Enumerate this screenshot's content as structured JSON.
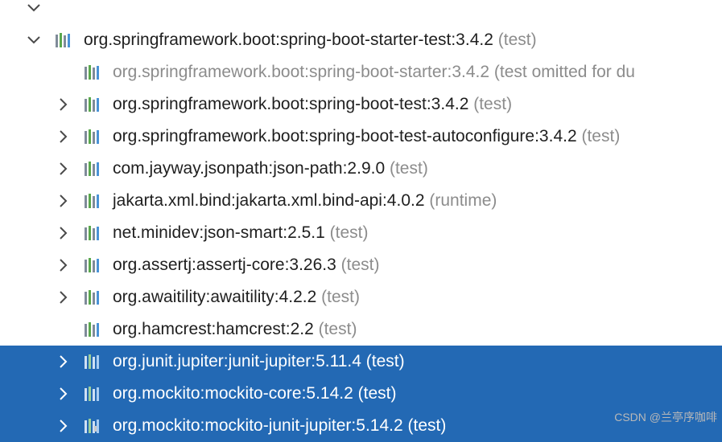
{
  "tree": {
    "top_partial": {
      "label": "org.springframework.boot:spring-boot-starter-test:3.4.2",
      "scope": "(test)",
      "expanded": true
    },
    "rows": [
      {
        "name": "",
        "scope": "",
        "expandable": false,
        "expanded": false,
        "omitted": false,
        "selected": false
      },
      {
        "name": "org.springframework.boot:spring-boot-starter-test:3.4.2",
        "scope": "(test)",
        "expandable": true,
        "expanded": true,
        "omitted": false,
        "selected": false,
        "depth": 0
      },
      {
        "name": "org.springframework.boot:spring-boot-starter:3.4.2",
        "scope": "(test omitted for du",
        "expandable": false,
        "expanded": false,
        "omitted": true,
        "selected": false,
        "depth": 1
      },
      {
        "name": "org.springframework.boot:spring-boot-test:3.4.2",
        "scope": "(test)",
        "expandable": true,
        "expanded": false,
        "omitted": false,
        "selected": false,
        "depth": 1
      },
      {
        "name": "org.springframework.boot:spring-boot-test-autoconfigure:3.4.2",
        "scope": "(test)",
        "expandable": true,
        "expanded": false,
        "omitted": false,
        "selected": false,
        "depth": 1
      },
      {
        "name": "com.jayway.jsonpath:json-path:2.9.0",
        "scope": "(test)",
        "expandable": true,
        "expanded": false,
        "omitted": false,
        "selected": false,
        "depth": 1
      },
      {
        "name": "jakarta.xml.bind:jakarta.xml.bind-api:4.0.2",
        "scope": "(runtime)",
        "expandable": true,
        "expanded": false,
        "omitted": false,
        "selected": false,
        "depth": 1
      },
      {
        "name": "net.minidev:json-smart:2.5.1",
        "scope": "(test)",
        "expandable": true,
        "expanded": false,
        "omitted": false,
        "selected": false,
        "depth": 1
      },
      {
        "name": "org.assertj:assertj-core:3.26.3",
        "scope": "(test)",
        "expandable": true,
        "expanded": false,
        "omitted": false,
        "selected": false,
        "depth": 1
      },
      {
        "name": "org.awaitility:awaitility:4.2.2",
        "scope": "(test)",
        "expandable": true,
        "expanded": false,
        "omitted": false,
        "selected": false,
        "depth": 1
      },
      {
        "name": "org.hamcrest:hamcrest:2.2",
        "scope": "(test)",
        "expandable": false,
        "expanded": false,
        "omitted": false,
        "selected": false,
        "depth": 1
      },
      {
        "name": "org.junit.jupiter:junit-jupiter:5.11.4",
        "scope": "(test)",
        "expandable": true,
        "expanded": false,
        "omitted": false,
        "selected": true,
        "depth": 1
      },
      {
        "name": "org.mockito:mockito-core:5.14.2",
        "scope": "(test)",
        "expandable": true,
        "expanded": false,
        "omitted": false,
        "selected": true,
        "depth": 1
      },
      {
        "name": "org.mockito:mockito-junit-jupiter:5.14.2",
        "scope": "(test)",
        "expandable": true,
        "expanded": false,
        "omitted": false,
        "selected": true,
        "depth": 1
      }
    ]
  },
  "icons": {
    "expanded": "chevron-down-icon",
    "collapsed": "chevron-right-icon",
    "library": "maven-library-icon"
  },
  "colors": {
    "selection": "#2369b4",
    "scope_text": "#8c8c8c",
    "omitted_text": "#8c8c8c",
    "text": "#1f1f1f"
  },
  "watermark": "CSDN @兰亭序咖啡"
}
